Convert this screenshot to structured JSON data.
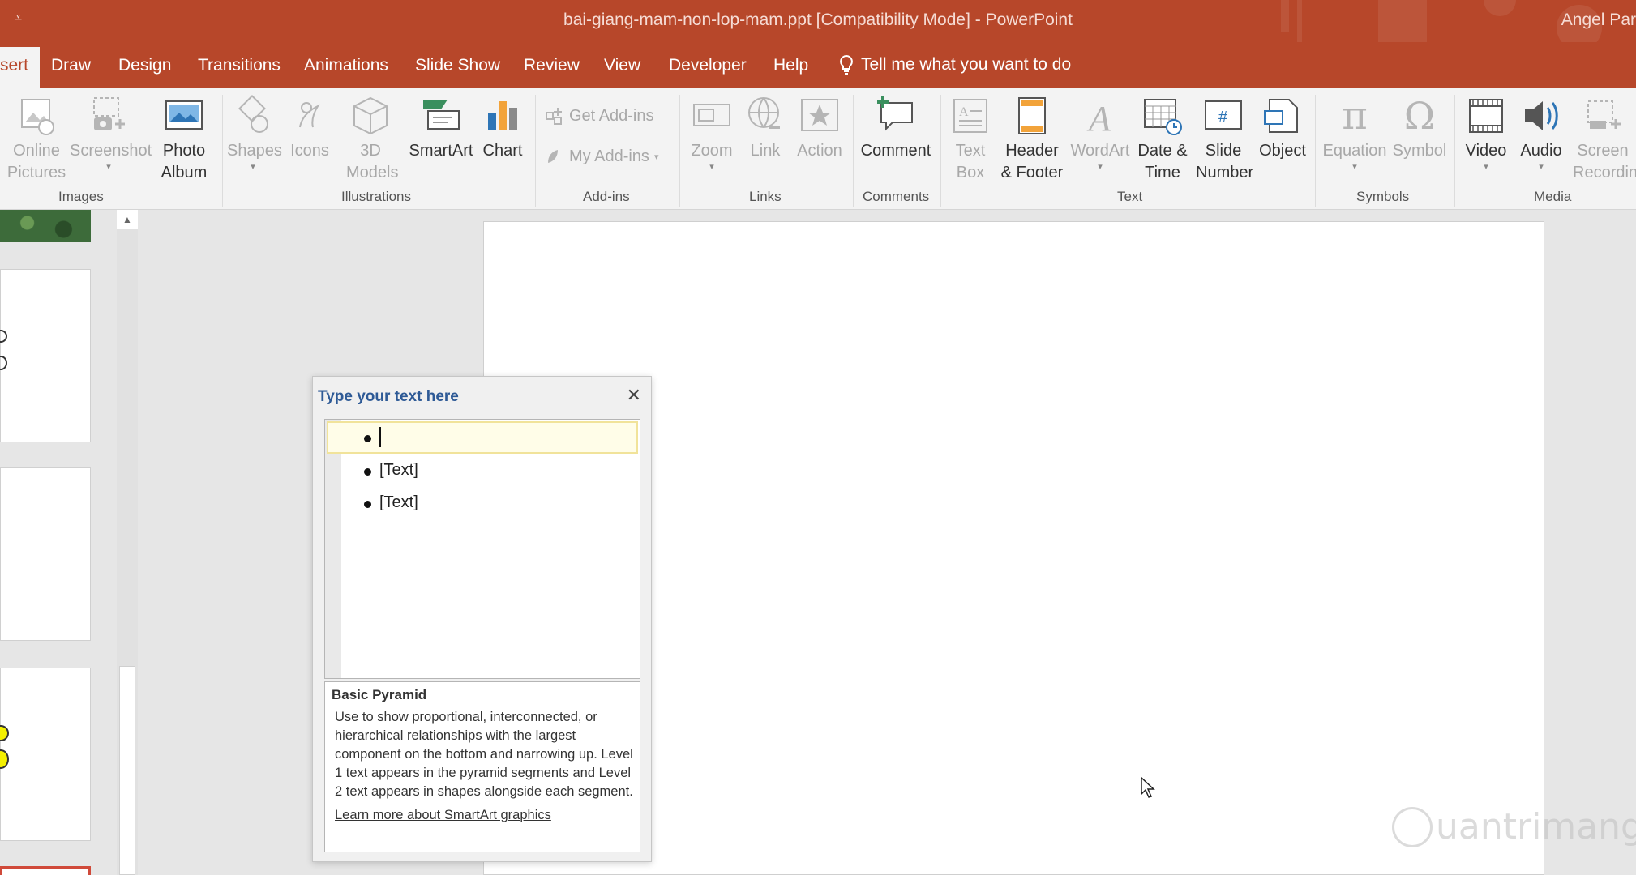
{
  "titlebar": {
    "qat_glyph": "⩡",
    "title": "bai-giang-mam-non-lop-mam.ppt [Compatibility Mode]  -  PowerPoint",
    "user": "Angel Par"
  },
  "tabs": {
    "items": [
      "sert",
      "Draw",
      "Design",
      "Transitions",
      "Animations",
      "Slide Show",
      "Review",
      "View",
      "Developer",
      "Help"
    ],
    "tell_me": "Tell me what you want to do"
  },
  "ribbon": {
    "images": {
      "online_pictures": "Online Pictures",
      "screenshot": "Screenshot",
      "photo_album": "Photo Album",
      "label": "Images"
    },
    "illustrations": {
      "shapes": "Shapes",
      "icons": "Icons",
      "models_3d": "3D Models",
      "smartart": "SmartArt",
      "chart": "Chart",
      "label": "Illustrations"
    },
    "addins": {
      "get": "Get Add-ins",
      "my": "My Add-ins",
      "label": "Add-ins"
    },
    "links": {
      "zoom": "Zoom",
      "link": "Link",
      "action": "Action",
      "label": "Links"
    },
    "comments": {
      "comment": "Comment",
      "label": "Comments"
    },
    "text": {
      "text_box": "Text Box",
      "header_footer": "Header & Footer",
      "wordart": "WordArt",
      "date_time": "Date & Time",
      "slide_number": "Slide Number",
      "object": "Object",
      "label": "Text"
    },
    "symbols": {
      "equation": "Equation",
      "symbol": "Symbol",
      "label": "Symbols",
      "pi": "π",
      "omega": "Ω"
    },
    "media": {
      "video": "Video",
      "audio": "Audio",
      "screen_recording": "Screen Recordin",
      "label": "Media"
    }
  },
  "text_pane": {
    "title": "Type your text here",
    "close": "✕",
    "items": [
      "",
      "[Text]",
      "[Text]"
    ],
    "description_title": "Basic Pyramid",
    "description": "Use to show proportional, interconnected, or hierarchical relationships with the largest component on the bottom and narrowing up. Level 1 text appears in the pyramid segments and Level 2 text appears in shapes alongside each segment.",
    "link": "Learn more about SmartArt graphics"
  },
  "scrollbar": {
    "up_arrow": "▲"
  },
  "watermark": {
    "text": "uantrimang"
  },
  "colors": {
    "accent": "#b7472a",
    "pane_title": "#2e5a96"
  }
}
